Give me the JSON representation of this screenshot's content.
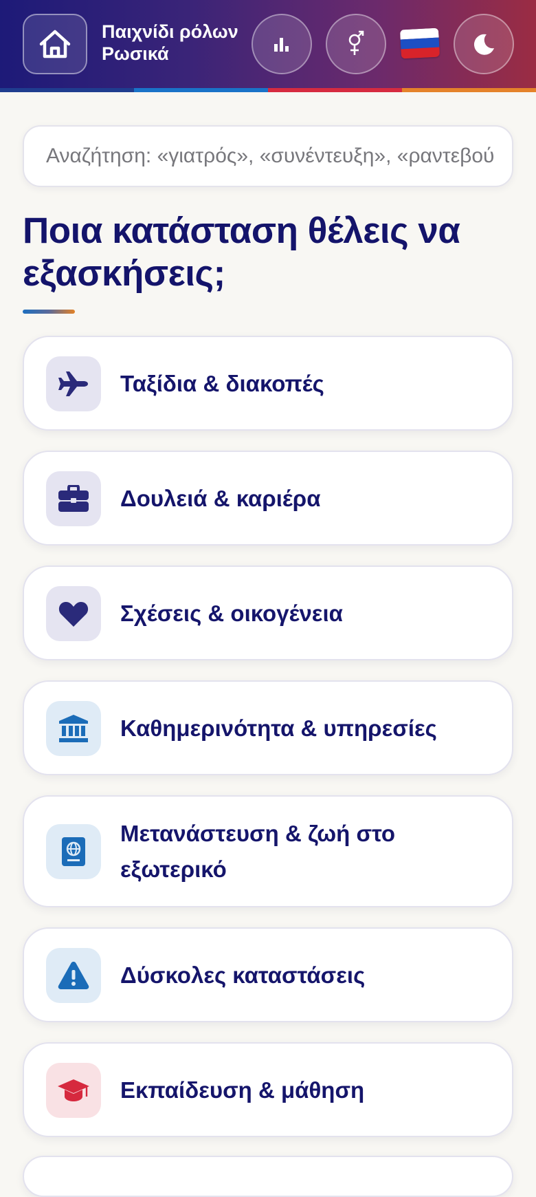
{
  "header": {
    "app_title": "Παιχνίδι ρόλων Ρωσικά",
    "home_icon": "home-icon",
    "stats_icon": "bar-chart-icon",
    "gender_icon": "gender-icon",
    "language_flag": "russia-flag-icon",
    "theme_icon": "moon-icon",
    "stripe_colors": [
      "#1f3d8f",
      "#1a73c8",
      "#d62b40",
      "#e5822a"
    ]
  },
  "search": {
    "placeholder": "Αναζήτηση: «γιατρός», «συνέντευξη», «ραντεβού»"
  },
  "main": {
    "heading": "Ποια κατάσταση θέλεις να εξασκήσεις;",
    "categories": [
      {
        "label": "Ταξίδια & διακοπές",
        "icon": "airplane-icon",
        "icon_bg": "#e5e4f1",
        "icon_color": "#2a2a7a"
      },
      {
        "label": "Δουλειά & καριέρα",
        "icon": "briefcase-icon",
        "icon_bg": "#e5e4f1",
        "icon_color": "#2a2a7a"
      },
      {
        "label": "Σχέσεις & οικογένεια",
        "icon": "heart-icon",
        "icon_bg": "#e5e4f1",
        "icon_color": "#2a2a7a"
      },
      {
        "label": "Καθημερινότητα & υπηρεσίες",
        "icon": "bank-icon",
        "icon_bg": "#dfebf6",
        "icon_color": "#1b6cb8"
      },
      {
        "label": "Μετανάστευση & ζωή στο εξωτερικό",
        "icon": "passport-icon",
        "icon_bg": "#dfebf6",
        "icon_color": "#1b6cb8"
      },
      {
        "label": "Δύσκολες καταστάσεις",
        "icon": "warning-icon",
        "icon_bg": "#dfebf6",
        "icon_color": "#1b6cb8"
      },
      {
        "label": "Εκπαίδευση & μάθηση",
        "icon": "graduation-cap-icon",
        "icon_bg": "#f9e1e4",
        "icon_color": "#d6293e"
      }
    ]
  },
  "colors": {
    "primary_text": "#15156b",
    "page_background": "#f8f7f3"
  }
}
